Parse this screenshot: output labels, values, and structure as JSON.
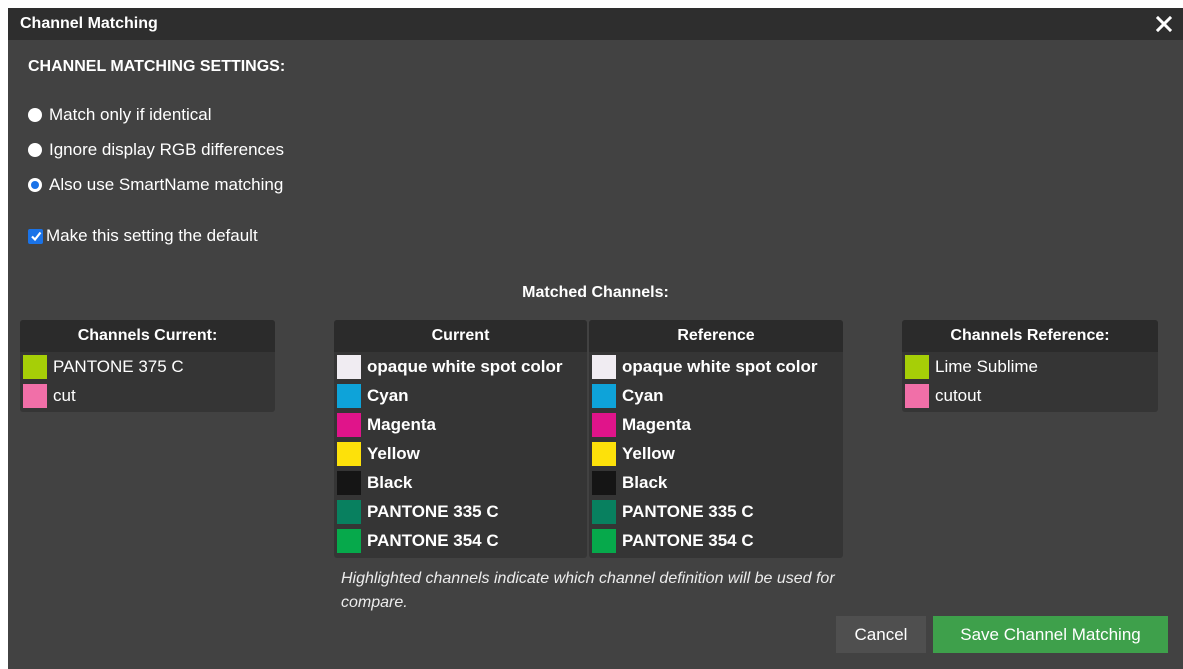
{
  "dialog": {
    "title": "Channel Matching",
    "close_icon": "close-icon"
  },
  "settings": {
    "heading": "CHANNEL MATCHING SETTINGS:",
    "options": [
      {
        "label": "Match only if identical",
        "checked": false
      },
      {
        "label": "Ignore display RGB differences",
        "checked": false
      },
      {
        "label": "Also use SmartName matching",
        "checked": true
      }
    ],
    "default_checkbox": {
      "label": "Make this setting the default",
      "checked": true
    }
  },
  "matched_heading": "Matched Channels:",
  "channels_current": {
    "header": "Channels Current:",
    "items": [
      {
        "name": "PANTONE 375 C",
        "color": "#a6cf07"
      },
      {
        "name": "cut",
        "color": "#f16fa8"
      }
    ]
  },
  "matched_current": {
    "header": "Current",
    "items": [
      {
        "name": "opaque white spot color",
        "color": "#f0ecf2"
      },
      {
        "name": "Cyan",
        "color": "#0ea3d9"
      },
      {
        "name": "Magenta",
        "color": "#e0148a"
      },
      {
        "name": "Yellow",
        "color": "#fde10a"
      },
      {
        "name": "Black",
        "color": "#151515"
      },
      {
        "name": "PANTONE 335 C",
        "color": "#08805f"
      },
      {
        "name": "PANTONE 354 C",
        "color": "#06a94b"
      }
    ]
  },
  "matched_reference": {
    "header": "Reference",
    "items": [
      {
        "name": "opaque white spot color",
        "color": "#f0ecf2"
      },
      {
        "name": "Cyan",
        "color": "#0ea3d9"
      },
      {
        "name": "Magenta",
        "color": "#e0148a"
      },
      {
        "name": "Yellow",
        "color": "#fde10a"
      },
      {
        "name": "Black",
        "color": "#151515"
      },
      {
        "name": "PANTONE 335 C",
        "color": "#08805f"
      },
      {
        "name": "PANTONE 354 C",
        "color": "#06a94b"
      }
    ]
  },
  "channels_reference": {
    "header": "Channels Reference:",
    "items": [
      {
        "name": "Lime Sublime",
        "color": "#a6cf07"
      },
      {
        "name": "cutout",
        "color": "#f16fa8"
      }
    ]
  },
  "note": "Highlighted channels indicate which channel definition will be used for compare.",
  "buttons": {
    "cancel": "Cancel",
    "save": "Save Channel Matching"
  },
  "colors": {
    "accent_blue": "#1a73e8",
    "save_green": "#3ea04b",
    "dialog_bg": "#424242",
    "titlebar_bg": "#2e2e2e"
  }
}
